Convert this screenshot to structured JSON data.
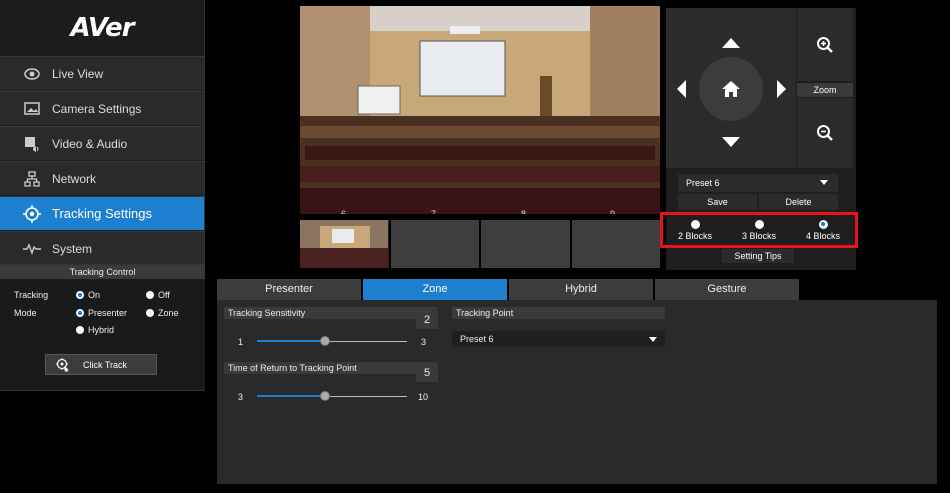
{
  "app": {
    "logo": "AVer"
  },
  "sidebar": {
    "items": [
      {
        "label": "Live View",
        "icon": "eye-icon"
      },
      {
        "label": "Camera Settings",
        "icon": "image-icon"
      },
      {
        "label": "Video & Audio",
        "icon": "video-audio-icon"
      },
      {
        "label": "Network",
        "icon": "network-icon"
      },
      {
        "label": "Tracking Settings",
        "icon": "target-icon",
        "active": true
      },
      {
        "label": "System",
        "icon": "pulse-icon"
      }
    ]
  },
  "tracking_control": {
    "title": "Tracking Control",
    "tracking_label": "Tracking",
    "tracking_on": "On",
    "tracking_off": "Off",
    "mode_label": "Mode",
    "mode_presenter": "Presenter",
    "mode_zone": "Zone",
    "mode_hybrid": "Hybrid",
    "click_track": "Click Track"
  },
  "preview": {
    "grid_numbers": [
      "6",
      "7",
      "8",
      "9"
    ]
  },
  "ptz": {
    "zoom_label": "Zoom",
    "preset": "Preset 6",
    "save": "Save",
    "delete": "Delete",
    "blocks": [
      "2 Blocks",
      "3 Blocks",
      "4 Blocks"
    ],
    "selected_block": "4 Blocks",
    "setting_tips": "Setting Tips"
  },
  "tabs": [
    "Presenter",
    "Zone",
    "Hybrid",
    "Gesture"
  ],
  "active_tab": "Zone",
  "zone": {
    "sensitivity": {
      "title": "Tracking Sensitivity",
      "value": "2",
      "min": "1",
      "max": "3"
    },
    "return_time": {
      "title": "Time of Return to Tracking Point",
      "value": "5",
      "min": "3",
      "max": "10"
    },
    "tracking_point": {
      "title": "Tracking Point",
      "value": "Preset 6"
    }
  },
  "colors": {
    "accent": "#1d7fd0",
    "highlight_box": "#e8141b"
  }
}
